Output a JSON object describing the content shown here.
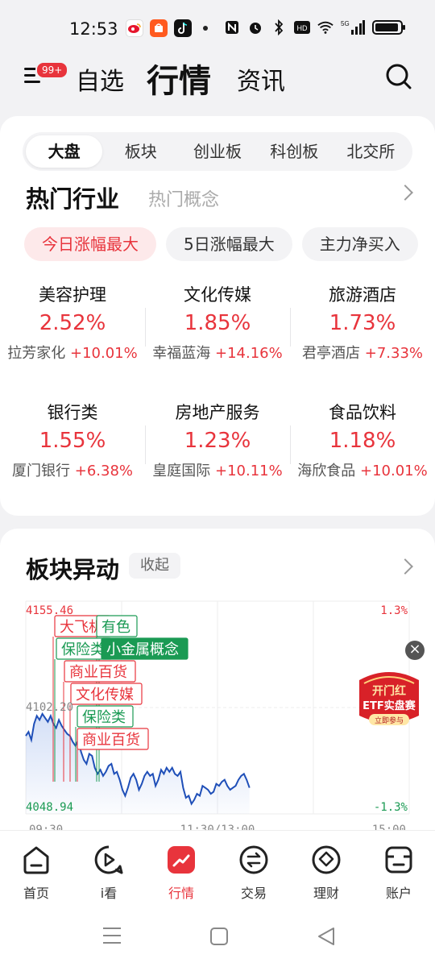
{
  "status": {
    "time": "12:53",
    "network": "5G"
  },
  "top_nav": {
    "badge": "99+",
    "tabs": [
      {
        "label": "自选"
      },
      {
        "label": "行情"
      },
      {
        "label": "资讯"
      }
    ]
  },
  "market_tabs": [
    "大盘",
    "板块",
    "创业板",
    "科创板",
    "北交所"
  ],
  "hot": {
    "title": "热门行业",
    "alt_title": "热门概念",
    "filters": [
      "今日涨幅最大",
      "5日涨幅最大",
      "主力净买入"
    ],
    "industries": [
      {
        "name": "美容护理",
        "pct": "2.52%",
        "lead": "拉芳家化",
        "lead_pct": "+10.01%"
      },
      {
        "name": "文化传媒",
        "pct": "1.85%",
        "lead": "幸福蓝海",
        "lead_pct": "+14.16%"
      },
      {
        "name": "旅游酒店",
        "pct": "1.73%",
        "lead": "君亭酒店",
        "lead_pct": "+7.33%"
      },
      {
        "name": "银行类",
        "pct": "1.55%",
        "lead": "厦门银行",
        "lead_pct": "+6.38%"
      },
      {
        "name": "房地产服务",
        "pct": "1.23%",
        "lead": "皇庭国际",
        "lead_pct": "+10.11%"
      },
      {
        "name": "食品饮料",
        "pct": "1.18%",
        "lead": "海欣食品",
        "lead_pct": "+10.01%"
      }
    ]
  },
  "anomaly": {
    "title": "板块异动",
    "collapse": "收起"
  },
  "chart_data": {
    "type": "line",
    "y_max_label": "4155.46",
    "y_mid_label": "4102.20",
    "y_min_label": "4048.94",
    "pct_max_label": "1.3%",
    "pct_min_label": "-1.3%",
    "x_labels": [
      "09:30",
      "11:30/13:00",
      "15:00"
    ],
    "ylim": [
      4048.94,
      4155.46
    ],
    "series": [
      {
        "values": [
          4088,
          4090,
          4086,
          4094,
          4098,
          4096,
          4099,
          4097,
          4095,
          4098,
          4094,
          4092,
          4096,
          4093,
          4091,
          4089,
          4088,
          4085,
          4083,
          4086,
          4080,
          4076,
          4074,
          4079,
          4078,
          4072,
          4069,
          4071,
          4068,
          4070,
          4073,
          4074,
          4069,
          4070,
          4066,
          4061,
          4058,
          4062,
          4067,
          4069,
          4066,
          4061,
          4064,
          4068,
          4070,
          4068,
          4069,
          4063,
          4066,
          4071,
          4069,
          4072,
          4070,
          4072,
          4069,
          4068,
          4070,
          4062,
          4057,
          4058,
          4054,
          4056,
          4059,
          4058,
          4063,
          4062,
          4061,
          4059,
          4060,
          4064,
          4063,
          4065,
          4066,
          4063,
          4061,
          4062,
          4063,
          4066,
          4068,
          4069,
          4066,
          4062
        ]
      }
    ],
    "events": [
      {
        "label": "大飞机",
        "kind": "up"
      },
      {
        "label": "有色",
        "kind": "down"
      },
      {
        "label": "保险类",
        "kind": "down"
      },
      {
        "label": "小金属概念",
        "kind": "hot"
      },
      {
        "label": "商业百货",
        "kind": "up"
      },
      {
        "label": "文化传媒",
        "kind": "up"
      },
      {
        "label": "保险类",
        "kind": "down"
      },
      {
        "label": "商业百货",
        "kind": "up"
      }
    ]
  },
  "promo": {
    "line1": "开门红",
    "line2": "ETF实盘赛",
    "line3": "立即参与"
  },
  "bottom_nav": [
    {
      "label": "首页",
      "icon": "home-icon"
    },
    {
      "label": "i看",
      "icon": "play-icon"
    },
    {
      "label": "行情",
      "icon": "market-icon"
    },
    {
      "label": "交易",
      "icon": "trade-icon"
    },
    {
      "label": "理财",
      "icon": "wealth-icon"
    },
    {
      "label": "账户",
      "icon": "account-icon"
    }
  ],
  "colors": {
    "up": "#e8343c",
    "down": "#1a9a53",
    "accent": "#e8343c",
    "line": "#1f4fb8"
  }
}
